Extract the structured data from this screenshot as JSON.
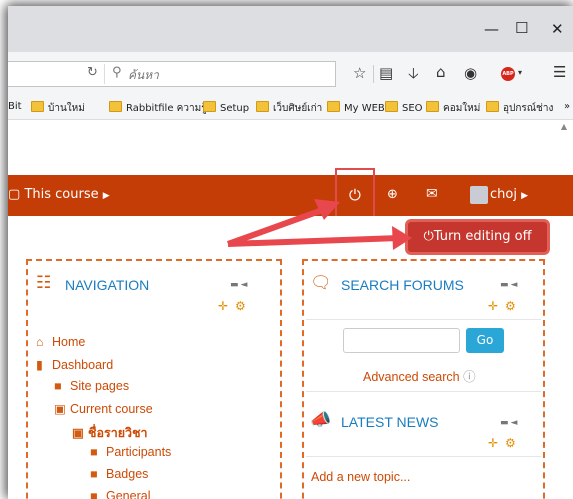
{
  "toolbar": {
    "search_placeholder": "ค้นหา",
    "adblock_label": "ABP"
  },
  "bookmarks": [
    "Bit",
    "บ้านใหม่",
    "Rabbitfile ความรู้",
    "Setup",
    "เว็บศิษย์เก่า",
    "My WEB",
    "SEO",
    "คอมใหม่",
    "อุปกรณ์ช่าง"
  ],
  "navbar": {
    "this_course": "This course",
    "username": "choj"
  },
  "edit_button": {
    "label": "Turn editing off"
  },
  "navigation": {
    "title": "NAVIGATION",
    "items": [
      "Home",
      "Dashboard",
      "Site pages",
      "Current course",
      "ชื่อรายวิชา",
      "Participants",
      "Badges",
      "General"
    ]
  },
  "search_forums": {
    "title": "SEARCH FORUMS",
    "go_label": "Go",
    "advanced_label": "Advanced search"
  },
  "latest_news": {
    "title": "LATEST NEWS",
    "add_topic": "Add a new topic..."
  },
  "colors": {
    "navbar_bg": "#c43d07",
    "accent": "#cd4a05",
    "heading": "#1a7cc0",
    "edit_button": "#c5362e",
    "go_button": "#2aa6d7",
    "annotation": "#e8484d"
  }
}
